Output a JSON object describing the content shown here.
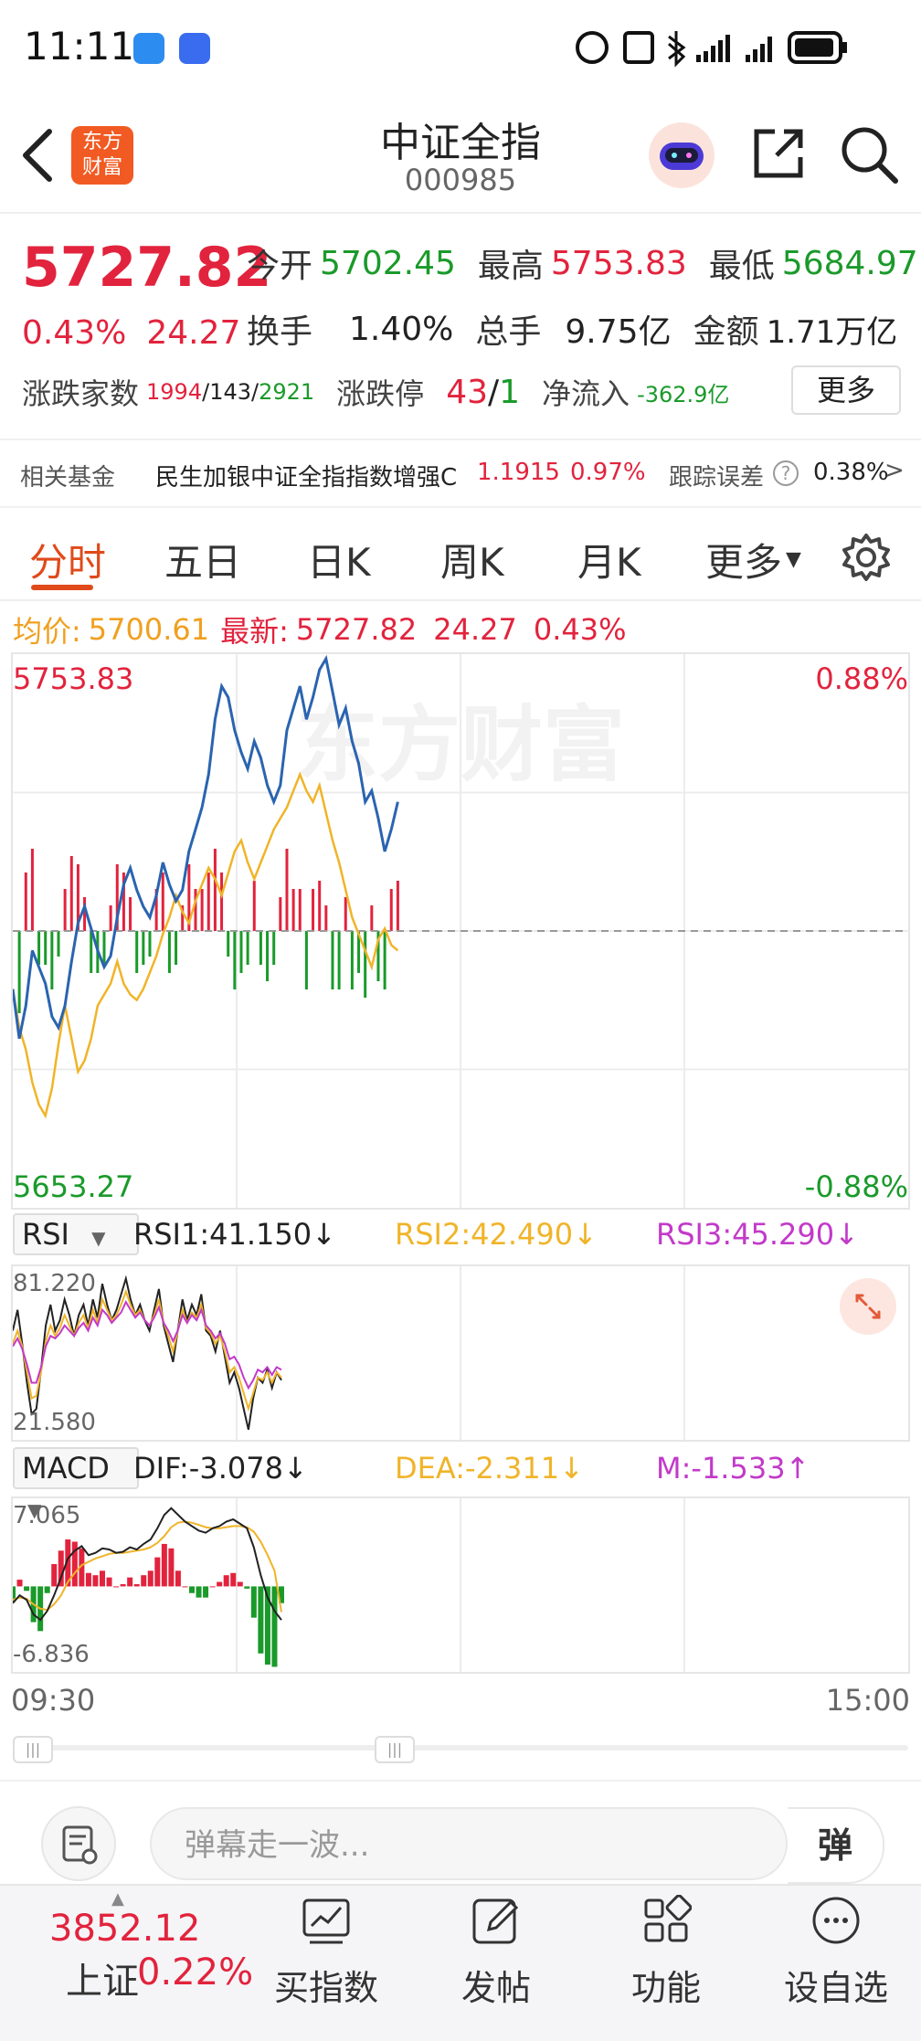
{
  "status_bar": {
    "time": "11:11"
  },
  "header": {
    "logo_text_1": "东方",
    "logo_text_2": "财富",
    "title": "中证全指",
    "code": "000985"
  },
  "quote": {
    "price": "5727.82",
    "change_pct": "0.43%",
    "change_abs": "24.27",
    "open_label": "今开",
    "open": "5702.45",
    "high_label": "最高",
    "high": "5753.83",
    "low_label": "最低",
    "low": "5684.97",
    "turnover_label": "换手",
    "turnover": "1.40%",
    "volume_label": "总手",
    "volume": "9.75亿",
    "amount_label": "金额",
    "amount": "1.71万亿",
    "breadth_label": "涨跌家数",
    "up": "1994",
    "flat": "143",
    "down": "2921",
    "limit_label": "涨跌停",
    "limit_up": "43",
    "limit_down": "1",
    "netflow_label": "净流入",
    "netflow": "-362.9亿",
    "more_label": "更多"
  },
  "fund": {
    "label": "相关基金",
    "name": "民生加银中证全指指数增强C",
    "nav": "1.1915",
    "pct": "0.97%",
    "track_label": "跟踪误差",
    "track_value": "0.38%",
    "arrow": ">"
  },
  "tabs": [
    "分时",
    "五日",
    "日K",
    "周K",
    "月K",
    "更多"
  ],
  "intraday": {
    "avg_label": "均价:",
    "avg": "5700.61",
    "latest_label": "最新:",
    "latest": "5727.82",
    "latest_chg": "24.27",
    "latest_pct": "0.43%",
    "y_top": "5753.83",
    "y_bottom": "5653.27",
    "pct_top": "0.88%",
    "pct_bottom": "-0.88%",
    "watermark": "东方财富",
    "time_start": "09:30",
    "time_end": "15:00"
  },
  "rsi": {
    "selector": "RSI",
    "rsi1": "RSI1:41.150↓",
    "rsi2": "RSI2:42.490↓",
    "rsi3": "RSI3:45.290↓",
    "top": "81.220",
    "bottom": "21.580"
  },
  "macd": {
    "selector": "MACD",
    "dif": "DIF:-3.078↓",
    "dea": "DEA:-2.311↓",
    "m": "M:-1.533↑",
    "top": "7.065",
    "bottom": "-6.836"
  },
  "colors": {
    "up": "#e2233d",
    "down": "#1a9a2a",
    "price_line": "#2a64b0",
    "avg_line": "#f0b429",
    "accent": "#e04a1a",
    "magenta": "#c23ac9"
  },
  "chart_data": [
    {
      "type": "line",
      "title": "",
      "xlabel": "",
      "ylabel": "",
      "x_range": [
        "09:30",
        "15:00"
      ],
      "ylim": [
        5653.27,
        5753.83
      ],
      "baseline": 5703.55,
      "series": [
        {
          "values": [
            5693,
            5684,
            5690,
            5700,
            5697,
            5694,
            5688,
            5686,
            5690,
            5698,
            5705,
            5708,
            5704,
            5700,
            5697,
            5699,
            5706,
            5712,
            5715,
            5711,
            5708,
            5706,
            5710,
            5716,
            5712,
            5709,
            5711,
            5718,
            5722,
            5726,
            5732,
            5742,
            5748,
            5746,
            5740,
            5736,
            5733,
            5738,
            5735,
            5730,
            5727,
            5730,
            5740,
            5744,
            5748,
            5742,
            5746,
            5751,
            5753,
            5747,
            5741,
            5744,
            5738,
            5734,
            5727,
            5729,
            5724,
            5718,
            5722,
            5727
          ]
        },
        {
          "values": [
            5693,
            5686,
            5682,
            5676,
            5672,
            5670,
            5675,
            5683,
            5690,
            5684,
            5678,
            5680,
            5684,
            5690,
            5692,
            5694,
            5698,
            5694,
            5692,
            5691,
            5693,
            5696,
            5699,
            5703,
            5706,
            5710,
            5707,
            5705,
            5709,
            5712,
            5715,
            5713,
            5710,
            5714,
            5718,
            5720,
            5716,
            5713,
            5716,
            5719,
            5722,
            5724,
            5726,
            5729,
            5732,
            5729,
            5727,
            5730,
            5725,
            5720,
            5716,
            5711,
            5706,
            5703,
            5700,
            5697,
            5702,
            5704,
            5701,
            5700
          ]
        }
      ]
    },
    {
      "type": "line",
      "title": "RSI",
      "ylim": [
        21.58,
        81.22
      ],
      "series": [
        {
          "name": "RSI1",
          "values": [
            60,
            68,
            55,
            40,
            28,
            30,
            45,
            62,
            70,
            60,
            64,
            72,
            66,
            58,
            66,
            70,
            62,
            72,
            65,
            78,
            70,
            64,
            68,
            74,
            80,
            72,
            66,
            70,
            64,
            60,
            68,
            76,
            62,
            55,
            48,
            60,
            72,
            64,
            70,
            66,
            74,
            60,
            58,
            52,
            60,
            50,
            40,
            44,
            38,
            30,
            22,
            34,
            42,
            40,
            45,
            38,
            44,
            41
          ]
        },
        {
          "name": "RSI2",
          "values": [
            55,
            60,
            54,
            44,
            34,
            35,
            44,
            56,
            62,
            58,
            61,
            66,
            62,
            58,
            63,
            66,
            61,
            68,
            63,
            72,
            68,
            64,
            66,
            70,
            75,
            70,
            66,
            68,
            64,
            62,
            66,
            72,
            63,
            58,
            52,
            60,
            68,
            63,
            67,
            65,
            70,
            61,
            59,
            55,
            58,
            52,
            44,
            46,
            42,
            36,
            30,
            36,
            42,
            41,
            44,
            40,
            44,
            42
          ]
        },
        {
          "name": "RSI3",
          "values": [
            54,
            57,
            53,
            47,
            40,
            40,
            46,
            54,
            58,
            57,
            59,
            62,
            60,
            58,
            61,
            63,
            60,
            65,
            62,
            68,
            66,
            63,
            65,
            67,
            71,
            68,
            65,
            67,
            64,
            62,
            65,
            69,
            63,
            60,
            56,
            60,
            66,
            63,
            66,
            64,
            68,
            62,
            60,
            57,
            59,
            55,
            49,
            50,
            47,
            42,
            38,
            41,
            45,
            44,
            46,
            43,
            46,
            45
          ]
        }
      ]
    },
    {
      "type": "bar",
      "title": "MACD",
      "ylim": [
        -6.836,
        7.065
      ],
      "series": [
        {
          "name": "DIF",
          "values": [
            -1.5,
            -0.8,
            -1.2,
            -2.5,
            -3.0,
            -2.2,
            -0.8,
            0.8,
            2.5,
            3.2,
            3.6,
            2.8,
            3.0,
            3.4,
            3.3,
            3.0,
            3.1,
            3.5,
            3.3,
            3.8,
            4.2,
            5.2,
            6.4,
            7.0,
            6.4,
            5.8,
            5.4,
            5.0,
            4.8,
            5.2,
            5.4,
            5.8,
            6.0,
            5.6,
            5.2,
            3.5,
            1.0,
            -1.0,
            -2.2,
            -3.0
          ]
        },
        {
          "name": "DEA",
          "values": [
            -1.2,
            -1.0,
            -1.1,
            -1.6,
            -2.0,
            -2.1,
            -1.6,
            -0.8,
            0.4,
            1.2,
            1.9,
            2.2,
            2.5,
            2.7,
            2.9,
            3.0,
            3.0,
            3.1,
            3.2,
            3.3,
            3.5,
            3.9,
            4.5,
            5.3,
            5.7,
            5.8,
            5.7,
            5.5,
            5.3,
            5.2,
            5.2,
            5.3,
            5.4,
            5.4,
            5.3,
            4.9,
            4.0,
            2.8,
            1.4,
            -2.3
          ]
        },
        {
          "name": "M",
          "values": [
            -1.4,
            0.6,
            -0.4,
            -3.2,
            -4.0,
            -0.6,
            2.0,
            3.2,
            4.2,
            4.0,
            3.4,
            1.2,
            1.0,
            1.4,
            0.8,
            0.0,
            0.2,
            0.8,
            0.2,
            1.0,
            1.4,
            2.6,
            3.8,
            3.4,
            1.4,
            0.0,
            -0.6,
            -1.0,
            -1.0,
            0.0,
            0.4,
            1.0,
            1.2,
            0.4,
            -0.2,
            -2.8,
            -6.0,
            -7.0,
            -7.2,
            -1.5
          ]
        }
      ]
    }
  ],
  "danmu": {
    "placeholder": "弹幕走一波...",
    "button": "弹"
  },
  "tabbar": {
    "index_value": "3852.12",
    "index_name": "上证",
    "index_pct": "0.22%",
    "buy": "买指数",
    "post": "发帖",
    "func": "功能",
    "watch": "设自选"
  }
}
